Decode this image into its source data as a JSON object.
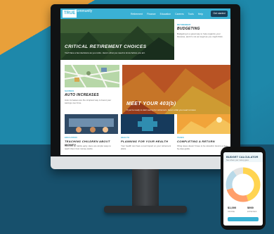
{
  "site": {
    "logo": "TRUE",
    "logo_sub": "Community",
    "nav_links": [
      "Retirement",
      "Finance",
      "Education",
      "Careers",
      "Tools",
      "Help"
    ],
    "nav_cta": "Get started"
  },
  "cards": [
    {
      "title": "CRITICAL RETIREMENT CHOICES",
      "text": "You'll face a few decisions as you retire. Here's what you need to know before you act."
    },
    {
      "kicker": "RETIREMENT",
      "title": "BUDGETING",
      "text": "Budgeting is a great way to help organize your finances, and it's not as tough as you might think."
    },
    {
      "kicker": "SAVINGS",
      "title": "AUTO INCREASES",
      "text": "Auto increases are the simplest way to boost your savings over time."
    },
    {
      "title": "MEET YOUR 403(b)",
      "text": "If you're ready to start saving for retirement, here's what you need to know."
    },
    {
      "kicker": "EDUCATION",
      "title": "TEACHING CHILDREN ABOUT MONEY",
      "text": "Kids pick up habits early. Here are simple ways to teach them how money works."
    },
    {
      "kicker": "HEALTH",
      "title": "PLANNING FOR YOUR HEALTH",
      "text": "Your health can have a real impact on your retirement plans."
    },
    {
      "kicker": "TAXES",
      "title": "COMPLETING A RETURN",
      "text": "Filing taxes doesn't have to be stressful. Here's a step-by-step guide."
    }
  ],
  "phone": {
    "title": "BUDGET CALCULATOR",
    "subtitle": "See where your money goes",
    "amount_left": "$1,000",
    "amount_right": "$900",
    "label_left": "INCOME",
    "label_right": "EXPENSES",
    "donut_shares": [
      0.45,
      0.25,
      0.2,
      0.1
    ],
    "donut_colors": [
      "#ffd451",
      "#ff9f6b",
      "#b9d9e8",
      "#e4e4e4"
    ]
  }
}
